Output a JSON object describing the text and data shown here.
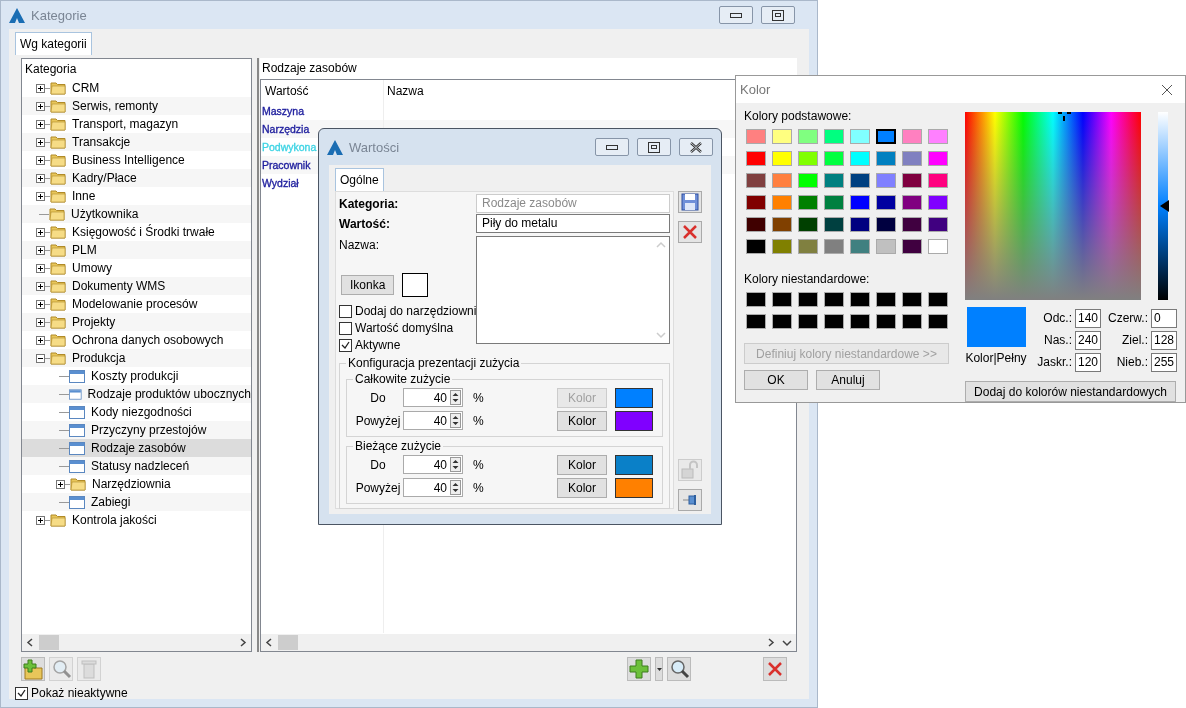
{
  "main_window": {
    "title": "Kategorie",
    "window_buttons": [
      {
        "kind": "minimize"
      },
      {
        "kind": "maximize"
      }
    ],
    "tabs": [
      {
        "label": "Wg kategorii",
        "selected": true
      }
    ],
    "tree": {
      "header": "Kategoria",
      "items": [
        {
          "label": "CRM",
          "kind": "folder",
          "expanded": false,
          "selected": false
        },
        {
          "label": "Serwis, remonty",
          "kind": "folder",
          "expanded": false,
          "selected": false
        },
        {
          "label": "Transport, magazyn",
          "kind": "folder",
          "expanded": false,
          "selected": false
        },
        {
          "label": "Transakcje",
          "kind": "folder",
          "expanded": false,
          "selected": false
        },
        {
          "label": "Business Intelligence",
          "kind": "folder",
          "expanded": false,
          "selected": false
        },
        {
          "label": "Kadry/Płace",
          "kind": "folder",
          "expanded": false,
          "selected": false
        },
        {
          "label": "Inne",
          "kind": "folder",
          "expanded": false,
          "selected": false
        },
        {
          "label": "Użytkownika",
          "kind": "leaf_folder",
          "selected": false
        },
        {
          "label": "Księgowość i Środki trwałe",
          "kind": "folder",
          "expanded": false,
          "selected": false
        },
        {
          "label": "PLM",
          "kind": "folder",
          "expanded": false,
          "selected": false
        },
        {
          "label": "Umowy",
          "kind": "folder",
          "expanded": false,
          "selected": false
        },
        {
          "label": "Dokumenty WMS",
          "kind": "folder",
          "expanded": false,
          "selected": false
        },
        {
          "label": "Modelowanie procesów",
          "kind": "folder",
          "expanded": false,
          "selected": false
        },
        {
          "label": "Projekty",
          "kind": "folder",
          "expanded": false,
          "selected": false
        },
        {
          "label": "Ochrona danych osobowych",
          "kind": "folder",
          "expanded": false,
          "selected": false
        },
        {
          "label": "Produkcja",
          "kind": "folder",
          "expanded": true,
          "selected": false,
          "children": [
            {
              "label": "Koszty produkcji",
              "kind": "form",
              "selected": false
            },
            {
              "label": "Rodzaje produktów ubocznych",
              "kind": "form",
              "selected": false
            },
            {
              "label": "Kody niezgodności",
              "kind": "form",
              "selected": false
            },
            {
              "label": "Przyczyny przestojów",
              "kind": "form",
              "selected": false
            },
            {
              "label": "Rodzaje zasobów",
              "kind": "form",
              "selected": true
            },
            {
              "label": "Statusy nadzleceń",
              "kind": "form",
              "selected": false
            },
            {
              "label": "Narzędziownia",
              "kind": "folder",
              "expanded": false,
              "selected": false
            },
            {
              "label": "Zabiegi",
              "kind": "form",
              "selected": false
            }
          ]
        },
        {
          "label": "Kontrola jakości",
          "kind": "folder",
          "expanded": false,
          "selected": false
        }
      ]
    },
    "list_panel": {
      "title": "Rodzaje zasobów",
      "columns": [
        "Wartość",
        "Nazwa"
      ],
      "rows": [
        {
          "value": "Maszyna",
          "color": "#1f1f9e"
        },
        {
          "value": "Narzędzia",
          "color": "#1f1f9e"
        },
        {
          "value": "Podwykona",
          "color": "#3fd4e4"
        },
        {
          "value": "Pracownik",
          "color": "#1f1f9e"
        },
        {
          "value": "Wydział",
          "color": "#1f1f9e"
        }
      ]
    },
    "left_toolbar": [
      {
        "kind": "add_folder",
        "disabled": false
      },
      {
        "kind": "search",
        "disabled": true
      },
      {
        "kind": "delete",
        "disabled": true
      }
    ],
    "show_inactive": {
      "label": "Pokaż nieaktywne",
      "checked": true
    },
    "right_toolbar": [
      {
        "kind": "add"
      },
      {
        "kind": "dropdown"
      },
      {
        "kind": "search"
      },
      {
        "kind": "delete"
      }
    ]
  },
  "values_dialog": {
    "title": "Wartości",
    "window_buttons": [
      {
        "kind": "minimize"
      },
      {
        "kind": "maximize"
      },
      {
        "kind": "close"
      }
    ],
    "tabs": [
      {
        "label": "Ogólne",
        "selected": true
      }
    ],
    "fields": [
      {
        "label": "Kategoria:",
        "value": "Rodzaje zasobów",
        "required": true,
        "disabled": true
      },
      {
        "label": "Wartość:",
        "value": "Piły do metalu",
        "required": true,
        "disabled": false
      }
    ],
    "name_label": "Nazwa:",
    "icon_button": "Ikonka",
    "checkboxes": [
      {
        "label": "Dodaj do narzędziowni",
        "checked": false
      },
      {
        "label": "Wartość domyślna",
        "checked": false
      },
      {
        "label": "Aktywne",
        "checked": true
      }
    ],
    "config": {
      "title": "Konfiguracja prezentacji zużycia",
      "groups": [
        {
          "title": "Całkowite zużycie",
          "rows": [
            {
              "label": "Do",
              "value": "40",
              "unit": "%",
              "button": "Kolor",
              "disabled": true,
              "color": "#0080ff"
            },
            {
              "label": "Powyżej",
              "value": "40",
              "unit": "%",
              "button": "Kolor",
              "disabled": false,
              "color": "#8000ff"
            }
          ]
        },
        {
          "title": "Bieżące zużycie",
          "rows": [
            {
              "label": "Do",
              "value": "40",
              "unit": "%",
              "button": "Kolor",
              "disabled": false,
              "color": "#0a80c8"
            },
            {
              "label": "Powyżej",
              "value": "40",
              "unit": "%",
              "button": "Kolor",
              "disabled": false,
              "color": "#ff8000"
            }
          ]
        }
      ]
    },
    "side_buttons": [
      {
        "kind": "save",
        "disabled": false
      },
      {
        "kind": "delete",
        "disabled": false
      },
      {
        "kind": "lock",
        "disabled": true
      },
      {
        "kind": "pin",
        "disabled": false
      }
    ]
  },
  "color_dialog": {
    "title": "Kolor",
    "basic_label": "Kolory podstawowe:",
    "basic_colors": [
      {
        "color": "#ff8080",
        "selected": false
      },
      {
        "color": "#ffff80",
        "selected": false
      },
      {
        "color": "#80ff80",
        "selected": false
      },
      {
        "color": "#00ff80",
        "selected": false
      },
      {
        "color": "#80ffff",
        "selected": false
      },
      {
        "color": "#0080ff",
        "selected": true
      },
      {
        "color": "#ff80c0",
        "selected": false
      },
      {
        "color": "#ff80ff",
        "selected": false
      },
      {
        "color": "#ff0000",
        "selected": false
      },
      {
        "color": "#ffff00",
        "selected": false
      },
      {
        "color": "#80ff00",
        "selected": false
      },
      {
        "color": "#00ff40",
        "selected": false
      },
      {
        "color": "#00ffff",
        "selected": false
      },
      {
        "color": "#0080c0",
        "selected": false
      },
      {
        "color": "#8080c0",
        "selected": false
      },
      {
        "color": "#ff00ff",
        "selected": false
      },
      {
        "color": "#804040",
        "selected": false
      },
      {
        "color": "#ff8040",
        "selected": false
      },
      {
        "color": "#00ff00",
        "selected": false
      },
      {
        "color": "#008080",
        "selected": false
      },
      {
        "color": "#004080",
        "selected": false
      },
      {
        "color": "#8080ff",
        "selected": false
      },
      {
        "color": "#800040",
        "selected": false
      },
      {
        "color": "#ff0080",
        "selected": false
      },
      {
        "color": "#800000",
        "selected": false
      },
      {
        "color": "#ff8000",
        "selected": false
      },
      {
        "color": "#008000",
        "selected": false
      },
      {
        "color": "#008040",
        "selected": false
      },
      {
        "color": "#0000ff",
        "selected": false
      },
      {
        "color": "#0000a0",
        "selected": false
      },
      {
        "color": "#800080",
        "selected": false
      },
      {
        "color": "#8000ff",
        "selected": false
      },
      {
        "color": "#400000",
        "selected": false
      },
      {
        "color": "#804000",
        "selected": false
      },
      {
        "color": "#004000",
        "selected": false
      },
      {
        "color": "#004040",
        "selected": false
      },
      {
        "color": "#000080",
        "selected": false
      },
      {
        "color": "#000040",
        "selected": false
      },
      {
        "color": "#400040",
        "selected": false
      },
      {
        "color": "#400080",
        "selected": false
      },
      {
        "color": "#000000",
        "selected": false
      },
      {
        "color": "#808000",
        "selected": false
      },
      {
        "color": "#808040",
        "selected": false
      },
      {
        "color": "#808080",
        "selected": false
      },
      {
        "color": "#408080",
        "selected": false
      },
      {
        "color": "#c0c0c0",
        "selected": false
      },
      {
        "color": "#400040",
        "selected": false
      },
      {
        "color": "#ffffff",
        "selected": false
      }
    ],
    "custom_label": "Kolory niestandardowe:",
    "custom_colors": [
      {
        "color": "#000000"
      },
      {
        "color": "#000000"
      },
      {
        "color": "#000000"
      },
      {
        "color": "#000000"
      },
      {
        "color": "#000000"
      },
      {
        "color": "#000000"
      },
      {
        "color": "#000000"
      },
      {
        "color": "#000000"
      },
      {
        "color": "#000000"
      },
      {
        "color": "#000000"
      },
      {
        "color": "#000000"
      },
      {
        "color": "#000000"
      },
      {
        "color": "#000000"
      },
      {
        "color": "#000000"
      },
      {
        "color": "#000000"
      },
      {
        "color": "#000000"
      }
    ],
    "define_button": {
      "label": "Definiuj kolory niestandardowe >>",
      "disabled": true
    },
    "ok_button": "OK",
    "cancel_button": "Anuluj",
    "luminance": {
      "level": 0.5
    },
    "preview": {
      "color": "#0080ff",
      "label": "Kolor|Pełny"
    },
    "values": [
      {
        "label": "Odc.:",
        "value": "140"
      },
      {
        "label": "Nas.:",
        "value": "240"
      },
      {
        "label": "Jaskr.:",
        "value": "120"
      },
      {
        "label": "Czerw.:",
        "value": "0"
      },
      {
        "label": "Ziel.:",
        "value": "128"
      },
      {
        "label": "Nieb.:",
        "value": "255"
      }
    ],
    "add_button": "Dodaj do kolorów niestandardowych"
  }
}
